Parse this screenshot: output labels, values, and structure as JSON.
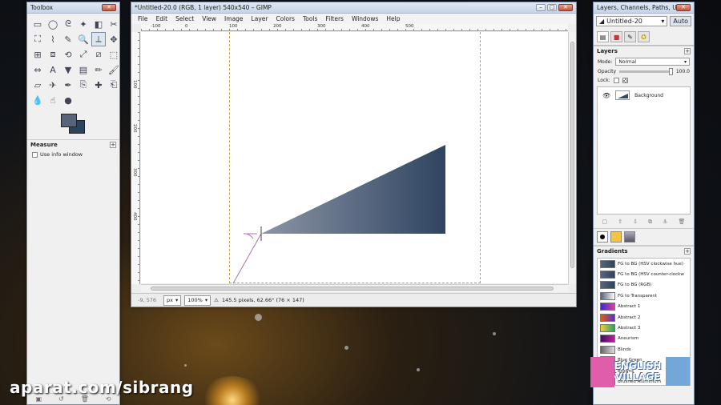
{
  "toolbox": {
    "title": "Toolbox",
    "tools": [
      "rect-select-icon",
      "ellipse-select-icon",
      "free-select-icon",
      "fuzzy-select-icon",
      "color-select-icon",
      "scissors-icon",
      "foreground-select-icon",
      "paths-icon",
      "color-picker-icon",
      "zoom-icon",
      "measure-icon",
      "move-icon",
      "align-icon",
      "crop-icon",
      "rotate-icon",
      "scale-icon",
      "shear-icon",
      "perspective-icon",
      "flip-icon",
      "text-icon",
      "bucket-fill-icon",
      "blend-icon",
      "pencil-icon",
      "paintbrush-icon",
      "eraser-icon",
      "airbrush-icon",
      "ink-icon",
      "clone-icon",
      "heal-icon",
      "perspective-clone-icon",
      "blur-icon",
      "smudge-icon",
      "dodge-burn-icon"
    ],
    "tool_glyphs": [
      "▭",
      "◯",
      "ᘓ",
      "✦",
      "◧",
      "✂",
      "⛶",
      "⌇",
      "✎",
      "🔍",
      "⟂",
      "✥",
      "⊞",
      "⧈",
      "⟲",
      "⤢",
      "⧄",
      "⬚",
      "⇔",
      "A",
      "▼",
      "▤",
      "✏",
      "🖌",
      "▱",
      "✈",
      "✒",
      "⎘",
      "✚",
      "⎗",
      "💧",
      "☝",
      "●"
    ],
    "selected_tool": 10,
    "measure_panel": {
      "title": "Measure",
      "option": "Use info window"
    }
  },
  "image_window": {
    "title": "*Untitled-20.0 (RGB, 1 layer) 540x540 – GIMP",
    "menu": [
      "File",
      "Edit",
      "Select",
      "View",
      "Image",
      "Layer",
      "Colors",
      "Tools",
      "Filters",
      "Windows",
      "Help"
    ],
    "ruler_h_labels": [
      "-100",
      "0",
      "100",
      "200",
      "300",
      "400",
      "500"
    ],
    "ruler_v_labels": [
      "100",
      "200",
      "300",
      "400"
    ],
    "status": {
      "coords": "-9, 576",
      "unit": "px",
      "zoom": "100%",
      "message": "145.5 pixels, 62.66° (76 × 147)"
    },
    "gradient": {
      "start_color": "#8b95a6",
      "end_color": "#2f4460"
    }
  },
  "dock": {
    "title": "Layers, Channels, Paths, Undo - Br...",
    "image_select": "Untitled-20",
    "auto_label": "Auto",
    "layers_label": "Layers",
    "mode_label": "Mode:",
    "mode_value": "Normal",
    "opacity_label": "Opacity",
    "opacity_value": "100.0",
    "lock_label": "Lock:",
    "layer_name": "Background",
    "gradients_label": "Gradients",
    "gradients": [
      {
        "name": "FG to BG (HSV clockwise hue)",
        "colors": [
          "#56657a",
          "#2f435e"
        ]
      },
      {
        "name": "FG to BG (HSV counter-clockw",
        "colors": [
          "#56657a",
          "#2f435e"
        ]
      },
      {
        "name": "FG to BG (RGB)",
        "colors": [
          "#56657a",
          "#2f435e"
        ]
      },
      {
        "name": "FG to Transparent",
        "colors": [
          "#56657a",
          "#ffffff"
        ]
      },
      {
        "name": "Abstract 1",
        "colors": [
          "#3b2ad0",
          "#e0409a"
        ]
      },
      {
        "name": "Abstract 2",
        "colors": [
          "#e05a20",
          "#6030c0"
        ]
      },
      {
        "name": "Abstract 3",
        "colors": [
          "#e8d040",
          "#30a060"
        ]
      },
      {
        "name": "Aneurism",
        "colors": [
          "#401060",
          "#c020a0"
        ]
      },
      {
        "name": "Blinds",
        "colors": [
          "#666666",
          "#dddddd"
        ]
      },
      {
        "name": "Blue Green",
        "colors": [
          "#2050c0",
          "#40c080"
        ]
      },
      {
        "name": "Browns",
        "colors": [
          "#804020",
          "#d0a060"
        ]
      },
      {
        "name": "Brushed Aluminium",
        "colors": [
          "#a0a0a0",
          "#e0e0e0"
        ]
      }
    ]
  },
  "overlay": {
    "watermark": "aparat.com/sibrang",
    "logo_line1": "ENGLISH",
    "logo_line2": "VILLAGE"
  }
}
